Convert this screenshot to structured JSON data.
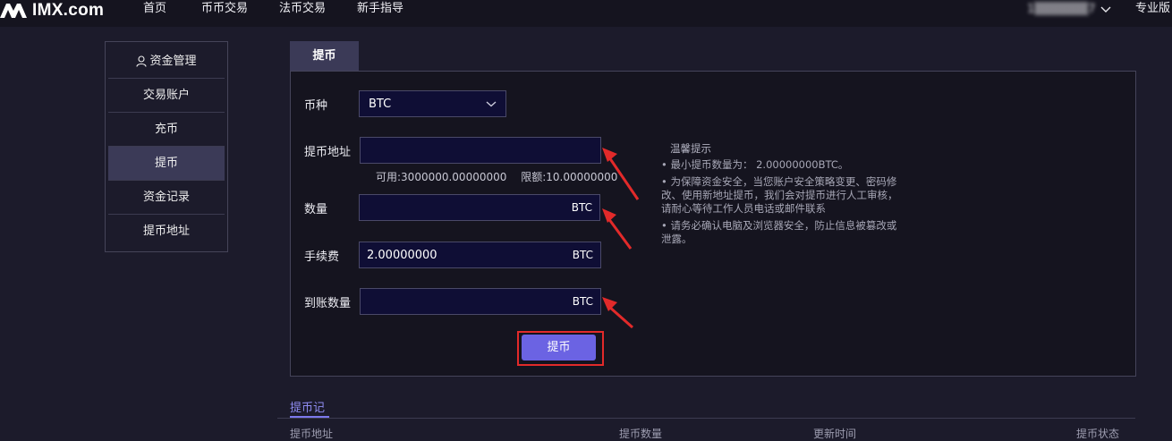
{
  "brand": {
    "name": "IMX.com"
  },
  "nav": [
    {
      "label": "首页"
    },
    {
      "label": "币币交易"
    },
    {
      "label": "法币交易"
    },
    {
      "label": "新手指导"
    }
  ],
  "user": {
    "name": "1▒▒▒▒▒▒7",
    "dropdown_icon": "chevron-down-icon"
  },
  "pro_label": "专业版",
  "sidebar": {
    "header": "资金管理",
    "header_icon": "user-icon",
    "items": [
      {
        "label": "交易账户"
      },
      {
        "label": "充币"
      },
      {
        "label": "提币"
      },
      {
        "label": "资金记录"
      },
      {
        "label": "提币地址"
      }
    ],
    "active": "提币"
  },
  "tab": {
    "label": "提币"
  },
  "form": {
    "currency_label": "币种",
    "currency_value": "BTC",
    "address_label": "提币地址",
    "address_value": "",
    "available": "可用:3000000.00000000",
    "limit": "限额:10.00000000",
    "amount_label": "数量",
    "amount_value": "",
    "amount_unit": "BTC",
    "fee_label": "手续费",
    "fee_value": "2.00000000",
    "fee_unit": "BTC",
    "received_label": "到账数量",
    "received_value": "",
    "received_unit": "BTC",
    "submit": "提币"
  },
  "tips": {
    "title": "温馨提示",
    "items": [
      "• 最小提币数量为： 2.00000000BTC。",
      "• 为保障资金安全，当您账户安全策略变更、密码修改、使用新地址提币，我们会对提币进行人工审核，请耐心等待工作人员电话或邮件联系",
      "• 请务必确认电脑及浏览器安全，防止信息被篡改或泄露。"
    ]
  },
  "records": {
    "tab": "提币记",
    "columns": [
      "提币地址",
      "提币数量",
      "更新时间",
      "提币状态"
    ]
  },
  "colors": {
    "accent": "#6b63e3",
    "highlight": "#e22a2a",
    "background": "#1c1b2b"
  }
}
